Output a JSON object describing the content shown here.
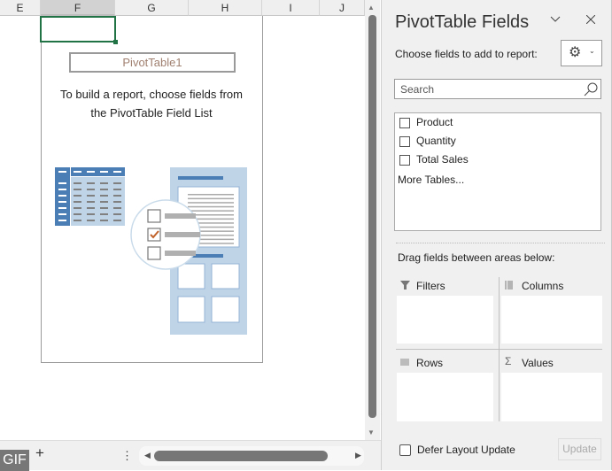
{
  "grid": {
    "columns": [
      "E",
      "F",
      "G",
      "H",
      "I",
      "J"
    ],
    "selected_column": "F"
  },
  "pivot": {
    "name": "PivotTable1",
    "instruction_line1": "To build a report, choose fields from",
    "instruction_line2": "the PivotTable Field List"
  },
  "bottom": {
    "gif_badge": "GIF",
    "add_sheet": "+",
    "more": "⋮"
  },
  "panel": {
    "title": "PivotTable Fields",
    "subtitle": "Choose fields to add to report:",
    "search_placeholder": "Search",
    "fields": [
      {
        "label": "Product",
        "checked": false
      },
      {
        "label": "Quantity",
        "checked": false
      },
      {
        "label": "Total Sales",
        "checked": false
      }
    ],
    "more_tables": "More Tables...",
    "drag_hint": "Drag fields between areas below:",
    "areas": {
      "filters": "Filters",
      "columns": "Columns",
      "rows": "Rows",
      "values": "Values"
    },
    "defer_label": "Defer Layout Update",
    "update_button": "Update"
  },
  "colors": {
    "accent": "#217346",
    "illustration_blue": "#4a7eb5",
    "illustration_light": "#c0d4e8"
  }
}
